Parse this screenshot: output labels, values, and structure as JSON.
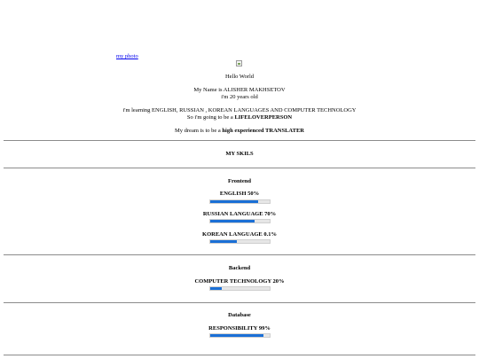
{
  "header": {
    "photo_alt": "my photo",
    "hello": "Hello World",
    "name_line": "My Name is ALISHER MAKHSETOV",
    "age_line": "i'm 20 years old",
    "learning_line": "i'm learning ENGLISH, RUSSIAN , KOREAN LANGUAGES AND COMPUTER TECHNOLOGY",
    "going_prefix": "So i'm going to be a ",
    "going_bold": "LIFELOVERPERSON",
    "dream_prefix": "My dream is to be a ",
    "dream_bold": "high experienced TRANSLATER"
  },
  "skills_title": "MY SKILS",
  "sections": [
    {
      "title": "Frontend",
      "skills": [
        {
          "label": "ENGLISH 50%",
          "level": 0.8
        },
        {
          "label": "RUSSIAN LANGUAGE 70%",
          "level": 0.75
        },
        {
          "label": "KOREAN LANGUAGE 0.1%",
          "level": 0.45
        }
      ]
    },
    {
      "title": "Backend",
      "skills": [
        {
          "label": "COMPUTER TECHNOLOGY 20%",
          "level": 0.2
        }
      ]
    },
    {
      "title": "Database",
      "skills": [
        {
          "label": "RESPONSIBILITY 99%",
          "level": 0.9
        }
      ]
    }
  ],
  "colors": {
    "bar_fill": "#1a6fd6",
    "link": "#0000ee"
  }
}
